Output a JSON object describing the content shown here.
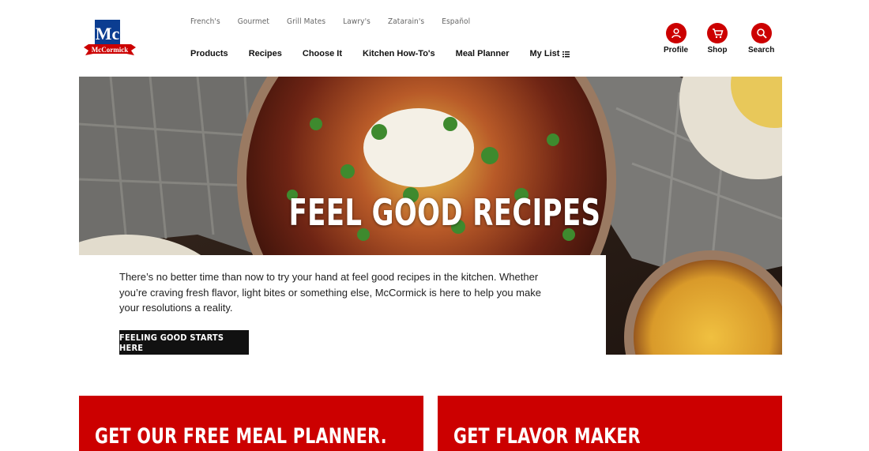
{
  "brand": {
    "logo_text": "McCormick",
    "logo_mark": "Mc"
  },
  "brand_links": [
    "French's",
    "Gourmet",
    "Grill Mates",
    "Lawry's",
    "Zatarain's",
    "Español"
  ],
  "main_nav": [
    "Products",
    "Recipes",
    "Choose It",
    "Kitchen How-To's",
    "Meal Planner",
    "My List"
  ],
  "utility": {
    "profile": {
      "label": "Profile",
      "icon": "person-icon"
    },
    "shop": {
      "label": "Shop",
      "icon": "cart-icon"
    },
    "search": {
      "label": "Search",
      "icon": "search-icon"
    }
  },
  "hero": {
    "title": "FEEL GOOD RECIPES",
    "body": "There’s no better time than now to try your hand at feel good recipes in the kitchen. Whether you’re craving fresh flavor, light bites or something else, McCormick is here to help you make your resolutions a reality.",
    "cta": "FEELING GOOD STARTS HERE"
  },
  "promos": [
    {
      "title": "GET OUR FREE MEAL PLANNER."
    },
    {
      "title": "GET FLAVOR MAKER"
    }
  ],
  "colors": {
    "brand_red": "#cc0000",
    "button_black": "#111111",
    "text": "#222222"
  }
}
